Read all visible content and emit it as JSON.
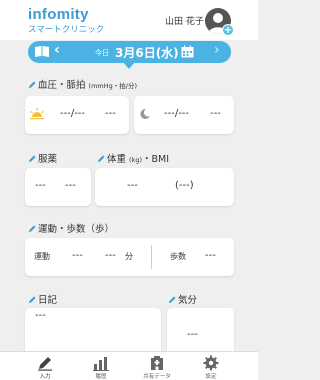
{
  "header": {
    "logo": "infomity",
    "logo_sub": "スマートクリニック",
    "user_name": "山田 花子",
    "avatar_plus": "+"
  },
  "datebar": {
    "prev": "‹",
    "next": "›",
    "today_label": "今日",
    "date": "3月6日(水)"
  },
  "bp": {
    "label": "血圧・脈拍",
    "unit": "(mmHg・拍/分)",
    "morning_value": "---/---",
    "morning_pulse": "---",
    "evening_value": "---/---",
    "evening_pulse": "---"
  },
  "medicine": {
    "label": "服薬",
    "value1": "---",
    "value2": "---"
  },
  "weight": {
    "label": "体重",
    "unit": "(kg)",
    "label2": "・BMI",
    "value": "---",
    "bmi": "(---)"
  },
  "exercise": {
    "label": "運動・歩数（歩）",
    "exercise_label": "運動",
    "ex_val1": "---",
    "ex_val2": "---",
    "ex_unit": "分",
    "steps_label": "歩数",
    "steps_val": "---"
  },
  "diary": {
    "label": "日記",
    "value": "---"
  },
  "mood": {
    "label": "気分",
    "value": "---"
  },
  "tabs": [
    {
      "label": "入力",
      "icon": "pencil-icon"
    },
    {
      "label": "履歴",
      "icon": "chart-icon"
    },
    {
      "label": "共有データ",
      "icon": "hospital-icon"
    },
    {
      "label": "設定",
      "icon": "gear-icon"
    }
  ],
  "colors": {
    "accent": "#4ab3e3",
    "brand": "#3d9bd4"
  }
}
